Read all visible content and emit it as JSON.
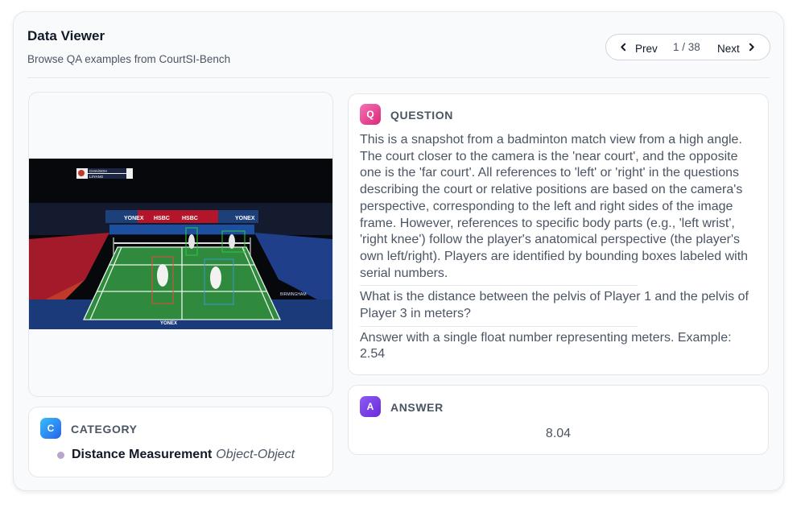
{
  "header": {
    "title": "Data Viewer",
    "subtitle": "Browse QA examples from CourtSI-Bench"
  },
  "pager": {
    "prev_label": "Prev",
    "next_label": "Next",
    "position": "1 / 38"
  },
  "image": {
    "scoreboard": {
      "row1": "CHIA/SOH",
      "row2": "LI/YANG"
    },
    "banner_text": "YONEX",
    "sponsor_text": "HSBC",
    "venue_text": "BIRMINGHAM"
  },
  "question": {
    "badge": "Q",
    "heading": "QUESTION",
    "context": "This is a snapshot from a badminton match view from a high angle. The court closer to the camera is the 'near court', and the opposite one is the 'far court'. All references to 'left' or 'right' in the questions describing the court or relative positions are based on the camera's perspective, corresponding to the left and right sides of the image frame. However, references to specific body parts (e.g., 'left wrist', 'right knee') follow the player's anatomical perspective (the player's own left/right). Players are identified by bounding boxes labeled with serial numbers.",
    "prompt": "What is the distance between the pelvis of Player 1 and the pelvis of Player 3 in meters?",
    "instruction": "Answer with a single float number representing meters. Example: 2.54"
  },
  "answer": {
    "badge": "A",
    "heading": "ANSWER",
    "value": "8.04"
  },
  "category": {
    "badge": "C",
    "heading": "CATEGORY",
    "name": "Distance Measurement",
    "subtype": "Object-Object"
  },
  "colors": {
    "accent_q": "#db2777",
    "accent_a": "#6d28d9",
    "accent_c": "#2563eb",
    "court_green": "#2f8a3e"
  }
}
